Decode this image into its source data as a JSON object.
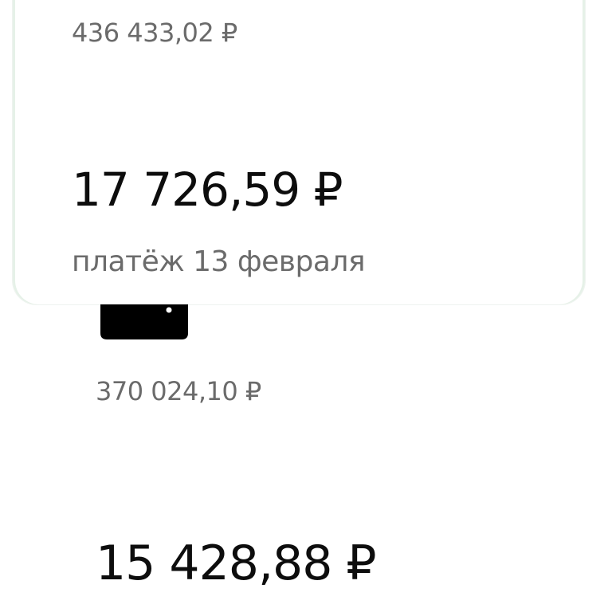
{
  "loans": [
    {
      "balance": "436 433,02 ₽",
      "payment_amount": "17 726,59 ₽",
      "payment_caption": "платёж 13 февраля"
    },
    {
      "balance": "370 024,10 ₽",
      "payment_amount": "15 428,88 ₽",
      "icon": "credit-card-icon"
    }
  ],
  "colors": {
    "card_border": "#e6f1e8",
    "primary_text": "#0d0d0d",
    "secondary_text": "#6b6b6b"
  }
}
